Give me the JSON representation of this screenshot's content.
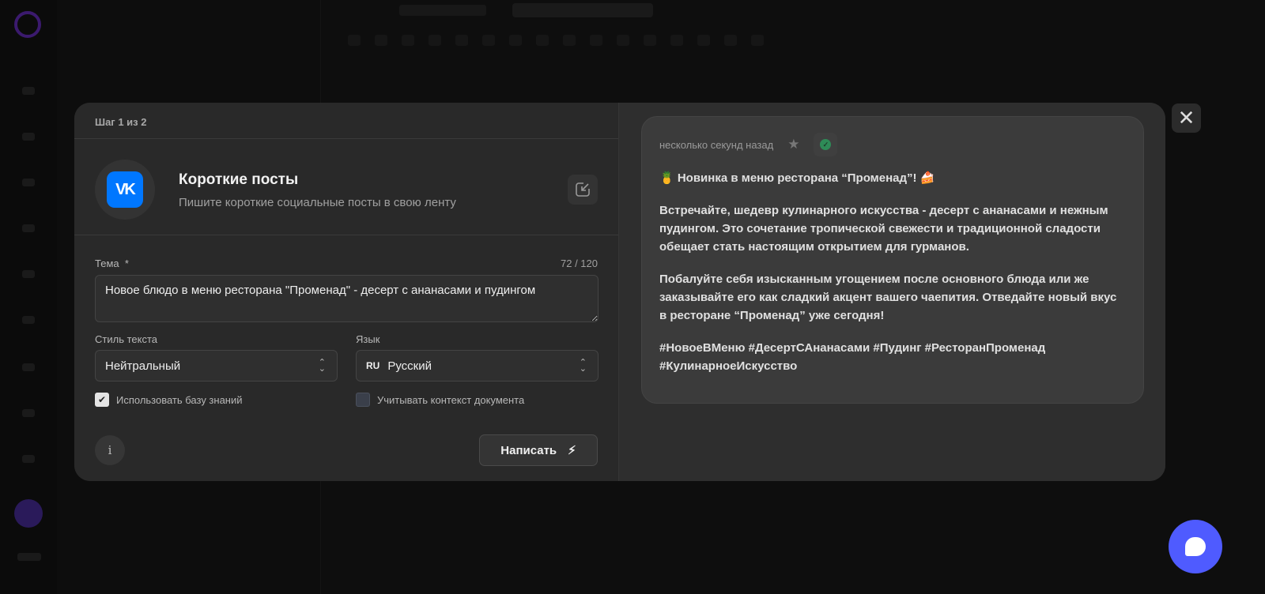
{
  "modal": {
    "step": "Шаг 1 из 2",
    "tool": {
      "icon_text": "VK",
      "title": "Короткие посты",
      "subtitle": "Пишите короткие социальные посты в свою ленту",
      "brand_color": "#0077ff"
    },
    "topic": {
      "label": "Тема",
      "required_mark": "*",
      "counter": "72 / 120",
      "value": "Новое блюдо в меню ресторана \"Променад\" - десерт с ананасами и пудингом"
    },
    "style": {
      "label": "Стиль текста",
      "value": "Нейтральный"
    },
    "language": {
      "label": "Язык",
      "code": "RU",
      "value": "Русский"
    },
    "checkboxes": [
      {
        "label": "Использовать базу знаний",
        "checked": true
      },
      {
        "label": "Учитывать контекст документа",
        "checked": false
      }
    ],
    "info_icon": "i",
    "write_button": "Написать"
  },
  "result": {
    "timestamp": "несколько секунд назад",
    "paragraphs": [
      "🍍 Новинка в меню ресторана “Променад”! 🍰",
      "Встречайте, шедевр кулинарного искусства - десерт с ананасами и нежным пудингом. Это сочетание тропической свежести и традиционной сладости обещает стать настоящим открытием для гурманов.",
      "Побалуйте себя изысканным угощением после основного блюда или же заказывайте его как сладкий акцент вашего чаепития. Отведайте новый вкус в ресторане “Променад” уже сегодня!",
      "#НовоеВМеню #ДесертСАнанасами #Пудинг #РесторанПроменад #КулинарноеИскусство"
    ]
  },
  "colors": {
    "chat_button": "#4f5bff",
    "accent_check": "#2e8b57"
  }
}
